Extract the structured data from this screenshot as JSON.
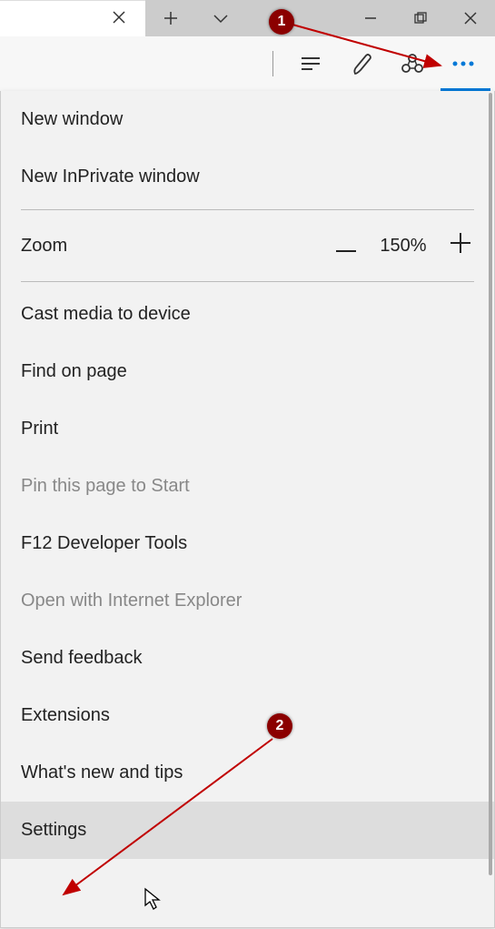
{
  "annotations": {
    "badge1": "1",
    "badge2": "2"
  },
  "zoom": {
    "label": "Zoom",
    "value": "150%"
  },
  "menu": {
    "new_window": "New window",
    "new_inprivate": "New InPrivate window",
    "cast": "Cast media to device",
    "find": "Find on page",
    "print": "Print",
    "pin": "Pin this page to Start",
    "devtools": "F12 Developer Tools",
    "open_ie": "Open with Internet Explorer",
    "feedback": "Send feedback",
    "extensions": "Extensions",
    "whatsnew": "What's new and tips",
    "settings": "Settings"
  }
}
